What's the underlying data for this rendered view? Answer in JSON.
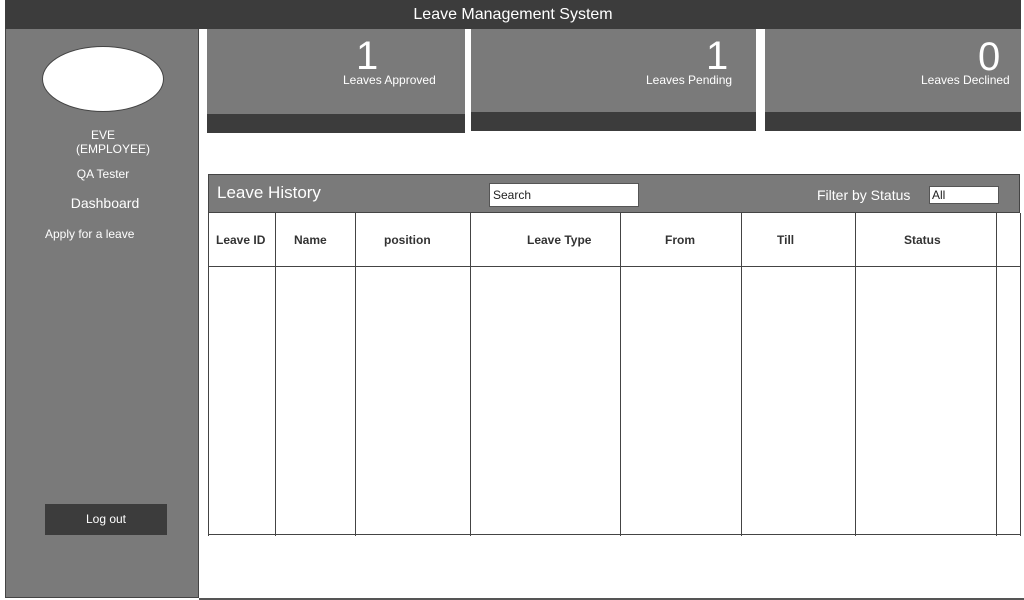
{
  "app": {
    "title": "Leave Management System"
  },
  "sidebar": {
    "user_name": "EVE",
    "user_role": "(EMPLOYEE)",
    "user_position": "QA Tester",
    "nav": {
      "dashboard": "Dashboard",
      "apply": "Apply for a leave"
    },
    "logout_label": "Log out"
  },
  "stats": {
    "approved": {
      "count": "1",
      "label": "Leaves Approved"
    },
    "pending": {
      "count": "1",
      "label": "Leaves Pending"
    },
    "declined": {
      "count": "0",
      "label": "Leaves Declined"
    }
  },
  "history": {
    "title": "Leave History",
    "search_value": "Search",
    "filter_label": "Filter by Status",
    "filter_value": "All",
    "columns": [
      "Leave ID",
      "Name",
      "position",
      "Leave Type",
      "From",
      "Till",
      "Status"
    ],
    "rows": []
  },
  "colors": {
    "dark": "#3c3c3c",
    "panel": "#7a7a7a"
  }
}
